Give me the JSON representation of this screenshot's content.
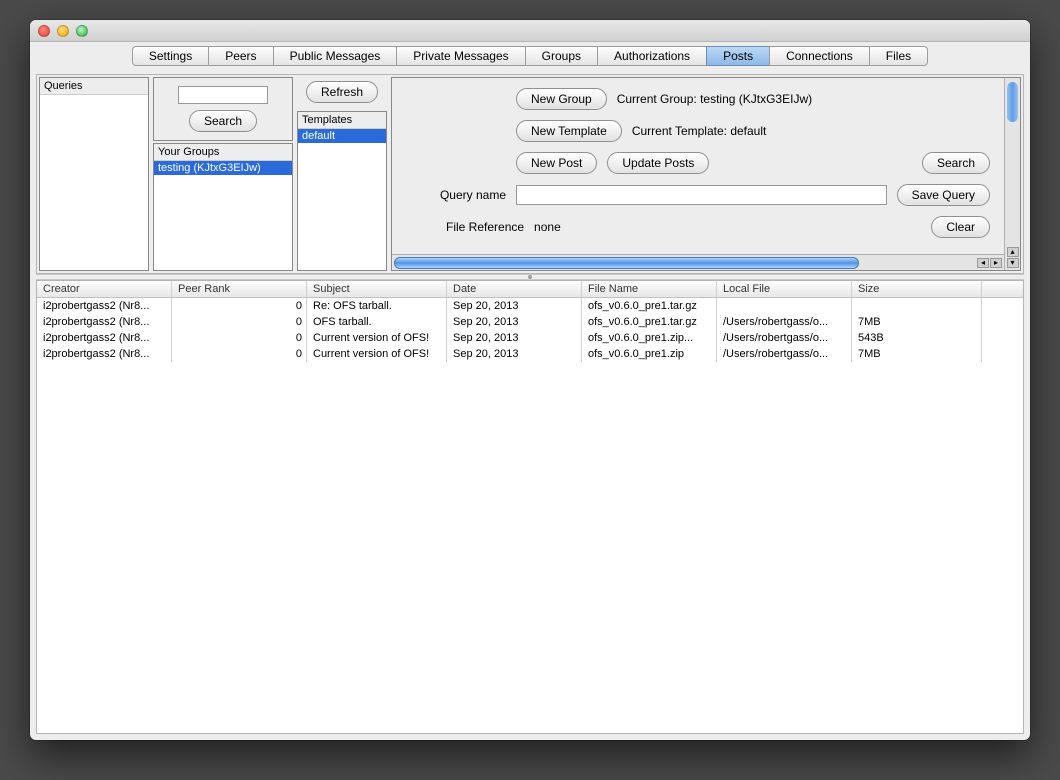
{
  "tabs": {
    "items": [
      "Settings",
      "Peers",
      "Public Messages",
      "Private Messages",
      "Groups",
      "Authorizations",
      "Posts",
      "Connections",
      "Files"
    ],
    "active": "Posts"
  },
  "queries": {
    "header": "Queries"
  },
  "groupsSearch": {
    "button": "Search"
  },
  "yourGroups": {
    "header": "Your Groups",
    "item0": "testing (KJtxG3EIJw)"
  },
  "templates": {
    "refresh": "Refresh",
    "header": "Templates",
    "item0": "default"
  },
  "main": {
    "newGroup": "New Group",
    "currentGroup": "Current Group: testing (KJtxG3EIJw)",
    "newTemplate": "New Template",
    "currentTemplate": "Current Template: default",
    "newPost": "New Post",
    "updatePosts": "Update Posts",
    "search": "Search",
    "queryNameLabel": "Query name",
    "queryNameValue": "",
    "saveQuery": "Save Query",
    "fileRefLabel": "File Reference",
    "fileRefValue": "none",
    "clear": "Clear"
  },
  "table": {
    "headers": {
      "creator": "Creator",
      "rank": "Peer Rank",
      "subject": "Subject",
      "date": "Date",
      "file": "File Name",
      "local": "Local File",
      "size": "Size"
    },
    "rows": [
      {
        "creator": "i2probertgass2 (Nr8...",
        "rank": "0",
        "subject": "Re: OFS tarball.",
        "date": "Sep 20, 2013",
        "file": "ofs_v0.6.0_pre1.tar.gz",
        "local": "",
        "size": ""
      },
      {
        "creator": "i2probertgass2 (Nr8...",
        "rank": "0",
        "subject": "OFS tarball.",
        "date": "Sep 20, 2013",
        "file": "ofs_v0.6.0_pre1.tar.gz",
        "local": "/Users/robertgass/o...",
        "size": "7MB"
      },
      {
        "creator": "i2probertgass2 (Nr8...",
        "rank": "0",
        "subject": "Current version of OFS!",
        "date": "Sep 20, 2013",
        "file": "ofs_v0.6.0_pre1.zip...",
        "local": "/Users/robertgass/o...",
        "size": "543B"
      },
      {
        "creator": "i2probertgass2 (Nr8...",
        "rank": "0",
        "subject": "Current version of OFS!",
        "date": "Sep 20, 2013",
        "file": "ofs_v0.6.0_pre1.zip",
        "local": "/Users/robertgass/o...",
        "size": "7MB"
      }
    ]
  }
}
